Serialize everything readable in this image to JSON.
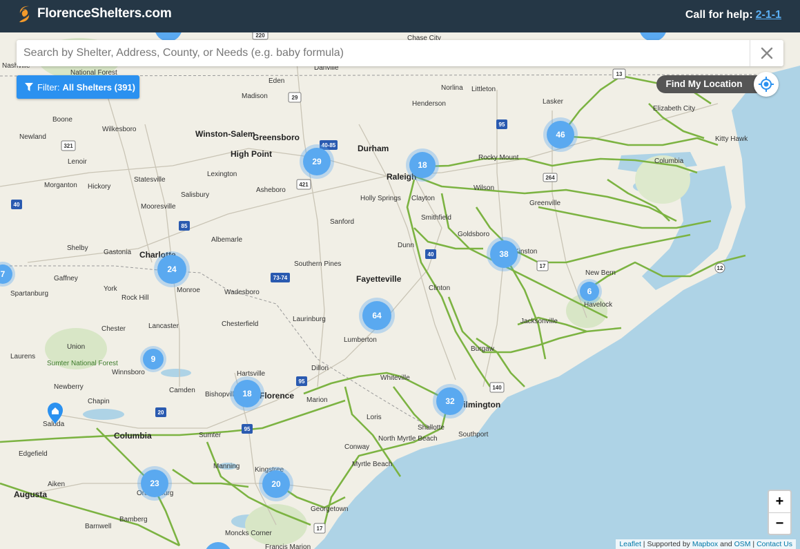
{
  "header": {
    "brand": "FlorenceShelters.com",
    "help_prefix": "Call for help:",
    "help_number": "2-1-1"
  },
  "search": {
    "placeholder": "Search by Shelter, Address, County, or Needs (e.g. baby formula)",
    "value": ""
  },
  "filter": {
    "label": "Filter:",
    "value": "All Shelters (391)"
  },
  "locate": {
    "label": "Find My Location"
  },
  "zoom": {
    "in": "+",
    "out": "−"
  },
  "attribution": {
    "leaflet": "Leaflet",
    "supported_by": "| Supported by",
    "mapbox": "Mapbox",
    "and": "and",
    "osm": "OSM",
    "sep": "|",
    "contact": "Contact Us"
  },
  "colors": {
    "header": "#253746",
    "accent": "#2b91f0",
    "cluster": "#5aa9f0",
    "evac_route": "#7cb342",
    "water": "#aed3e6",
    "land": "#f1efe6"
  },
  "clusters": [
    {
      "count": "29"
    },
    {
      "count": "18"
    },
    {
      "count": "46"
    },
    {
      "count": "24"
    },
    {
      "count": "38"
    },
    {
      "count": "7"
    },
    {
      "count": "6"
    },
    {
      "count": "64"
    },
    {
      "count": "9"
    },
    {
      "count": "18"
    },
    {
      "count": "32"
    },
    {
      "count": "23"
    },
    {
      "count": "20"
    }
  ],
  "places": [
    "Danville",
    "Eden",
    "Madison",
    "Norlina",
    "Littleton",
    "Henderson",
    "Lasker",
    "Elizabeth City",
    "Boone",
    "Wilkesboro",
    "Winston-Salem",
    "Greensboro",
    "High Point",
    "Durham",
    "Raleigh",
    "Rocky Mount",
    "Newland",
    "Lenoir",
    "Morganton",
    "Hickory",
    "Statesville",
    "Lexington",
    "Asheboro",
    "Wilson",
    "Columbia",
    "Kitty Hawk",
    "Salisbury",
    "Holly Springs",
    "Clayton",
    "Greenville",
    "Mooresville",
    "Sanford",
    "Smithfield",
    "Goldsboro",
    "Shelby",
    "Gastonia",
    "Charlotte",
    "Albemarle",
    "Dunn",
    "Kinston",
    "Southern Pines",
    "Spartanburg",
    "Gaffney",
    "York",
    "Rock Hill",
    "Monroe",
    "Wadesboro",
    "Fayetteville",
    "New Bern",
    "Havelock",
    "Clinton",
    "Laurinburg",
    "Lancaster",
    "Chesterfield",
    "Chester",
    "Union",
    "Jacksonville",
    "Lumberton",
    "Laurens",
    "Sumter National Forest",
    "Winnsboro",
    "Hartsville",
    "Dillon",
    "Burgaw",
    "Whiteville",
    "Newberry",
    "Camden",
    "Bishopville",
    "Florence",
    "Marion",
    "Wilmington",
    "Chapin",
    "Saluda",
    "Columbia",
    "Sumter",
    "Loris",
    "Shallotte",
    "Southport",
    "North Myrtle Beach",
    "Edgefield",
    "Conway",
    "Myrtle Beach",
    "Manning",
    "Kingstree",
    "Aiken",
    "Augusta",
    "Orangeburg",
    "Georgetown",
    "Bamberg",
    "Barnwell",
    "Moncks Corner",
    "Francis Marion",
    "Chase City",
    "National Forest",
    "Nashville"
  ],
  "road_shields": [
    "220",
    "29",
    "13",
    "95",
    "321",
    "40-85",
    "421",
    "264",
    "40",
    "85",
    "40",
    "73-74",
    "17",
    "95",
    "20",
    "95",
    "17",
    "140",
    "12"
  ]
}
